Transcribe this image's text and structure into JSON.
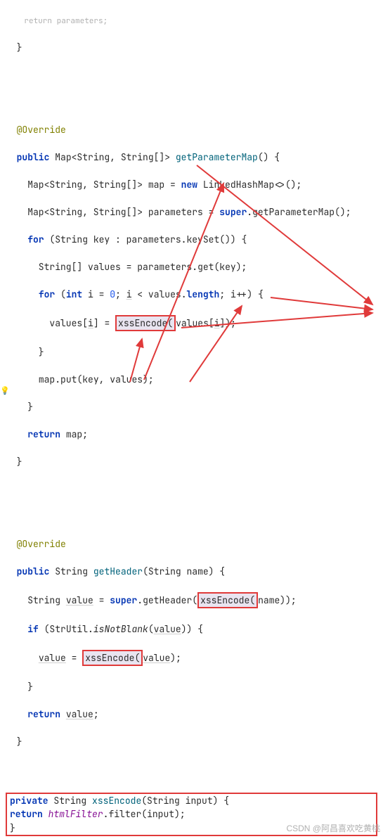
{
  "code": {
    "l1": "return parameters;",
    "l2": "}",
    "ann_override1": "@Override",
    "kw_public": "public",
    "kw_new": "new",
    "kw_super": "super",
    "kw_for": "for",
    "kw_int": "int",
    "kw_return": "return",
    "kw_if": "if",
    "kw_private": "private",
    "type_map": "Map<String, String[]>",
    "method_getParameterMap": "getParameterMap",
    "type_linked": "LinkedHashMap<>",
    "var_map": "map",
    "var_parameters": "parameters",
    "method_keySet": "keySet",
    "prop_length": "length",
    "var_values": "values",
    "var_key": "key",
    "var_i": "i",
    "num_0": "0",
    "method_get": "get",
    "method_put": "put",
    "call_xssEncode": "xssEncode",
    "ann_override2": "@Override",
    "type_string": "String",
    "method_getHeader": "getHeader",
    "param_name": "name",
    "var_value": "value",
    "class_StrUtil": "StrUtil",
    "method_isNotBlank": "isNotBlank",
    "method_xssEncode": "xssEncode",
    "param_input": "input",
    "field_htmlFilter": "htmlFilter",
    "method_filter": "filter"
  },
  "watermark": "CSDN @阿昌喜欢吃黄桃"
}
